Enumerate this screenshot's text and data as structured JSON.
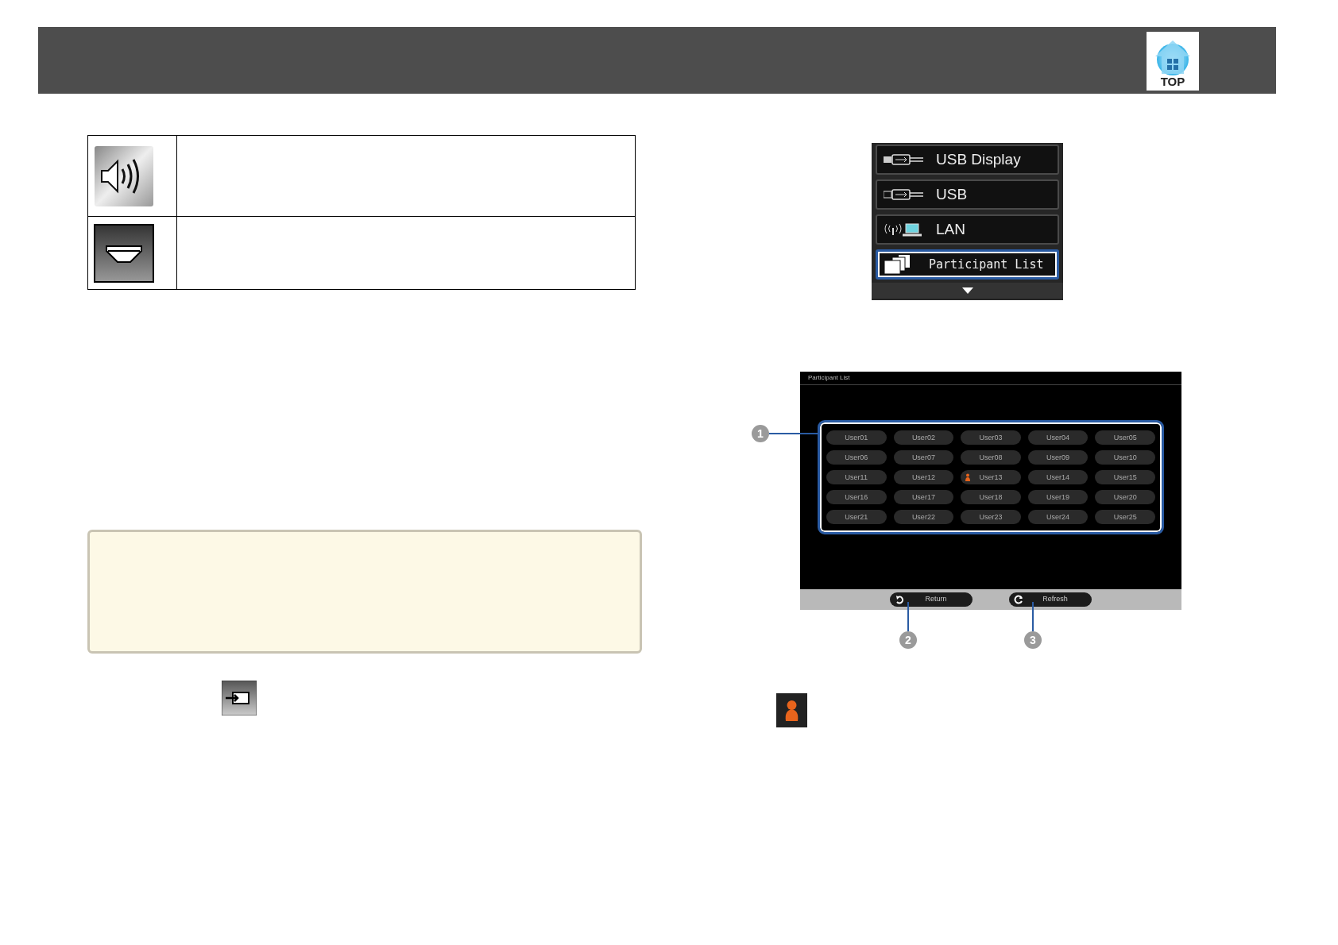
{
  "header": {
    "top_button": "TOP"
  },
  "icon_table": {
    "rows": [
      {
        "kind": "speaker"
      },
      {
        "kind": "eject"
      }
    ]
  },
  "menu": {
    "items": [
      {
        "label": "USB Display",
        "kind": "usb-display",
        "selected": false
      },
      {
        "label": "USB",
        "kind": "usb",
        "selected": false
      },
      {
        "label": "LAN",
        "kind": "lan",
        "selected": false
      },
      {
        "label": "Participant List",
        "kind": "participants",
        "selected": true
      }
    ]
  },
  "participant_screen": {
    "title": "Participant List",
    "users": [
      {
        "label": "User01",
        "projecting": false
      },
      {
        "label": "User02",
        "projecting": false
      },
      {
        "label": "User03",
        "projecting": false
      },
      {
        "label": "User04",
        "projecting": false
      },
      {
        "label": "User05",
        "projecting": false
      },
      {
        "label": "User06",
        "projecting": false
      },
      {
        "label": "User07",
        "projecting": false
      },
      {
        "label": "User08",
        "projecting": false
      },
      {
        "label": "User09",
        "projecting": false
      },
      {
        "label": "User10",
        "projecting": false
      },
      {
        "label": "User11",
        "projecting": false
      },
      {
        "label": "User12",
        "projecting": false
      },
      {
        "label": "User13",
        "projecting": true
      },
      {
        "label": "User14",
        "projecting": false
      },
      {
        "label": "User15",
        "projecting": false
      },
      {
        "label": "User16",
        "projecting": false
      },
      {
        "label": "User17",
        "projecting": false
      },
      {
        "label": "User18",
        "projecting": false
      },
      {
        "label": "User19",
        "projecting": false
      },
      {
        "label": "User20",
        "projecting": false
      },
      {
        "label": "User21",
        "projecting": false
      },
      {
        "label": "User22",
        "projecting": false
      },
      {
        "label": "User23",
        "projecting": false
      },
      {
        "label": "User24",
        "projecting": false
      },
      {
        "label": "User25",
        "projecting": false
      }
    ],
    "buttons": [
      {
        "label": "Return",
        "kind": "return"
      },
      {
        "label": "Refresh",
        "kind": "refresh"
      }
    ]
  },
  "callouts": [
    "1",
    "2",
    "3"
  ]
}
